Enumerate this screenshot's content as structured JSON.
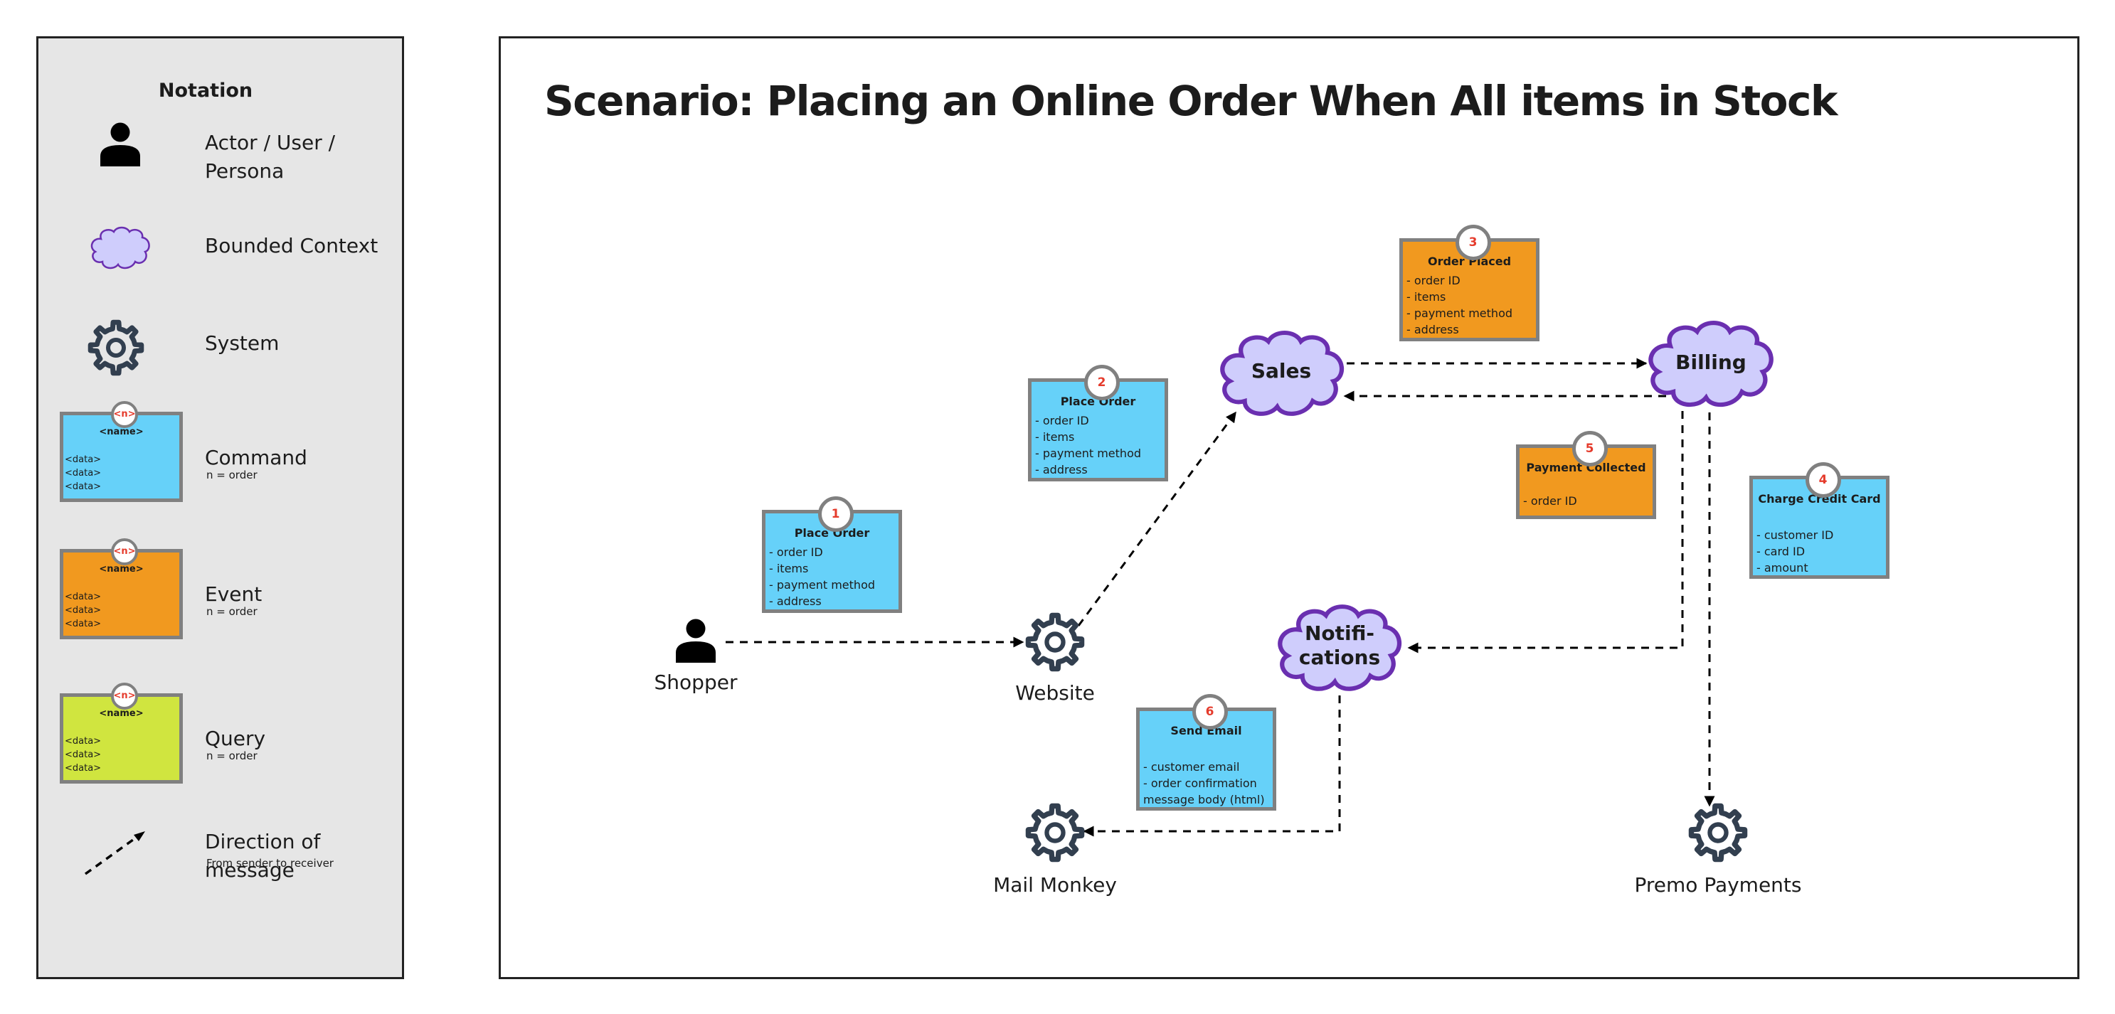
{
  "legend": {
    "title": "Notation",
    "items": [
      {
        "icon": "actor-icon",
        "label_line1": "Actor / User /",
        "label_line2": "Persona"
      },
      {
        "icon": "bounded-context-cloud-icon",
        "label": "Bounded Context"
      },
      {
        "icon": "system-gear-icon",
        "label": "System"
      },
      {
        "icon": "command-card",
        "label": "Command",
        "sub": "n = order",
        "card": {
          "badge": "<n>",
          "name": "<name>",
          "lines": [
            "<data>",
            "<data>",
            "<data>"
          ]
        }
      },
      {
        "icon": "event-card",
        "label": "Event",
        "sub": "n = order",
        "card": {
          "badge": "<n>",
          "name": "<name>",
          "lines": [
            "<data>",
            "<data>",
            "<data>"
          ]
        }
      },
      {
        "icon": "query-card",
        "label": "Query",
        "sub": "n = order",
        "card": {
          "badge": "<n>",
          "name": "<name>",
          "lines": [
            "<data>",
            "<data>",
            "<data>"
          ]
        }
      },
      {
        "icon": "dashed-arrow-icon",
        "label": "Direction of message",
        "sub": "From sender to receiver"
      }
    ]
  },
  "scenario": {
    "title": "Scenario: Placing an Online Order When All items in Stock",
    "actors": [
      {
        "name": "Shopper"
      }
    ],
    "systems": [
      {
        "name": "Website"
      },
      {
        "name": "Mail Monkey"
      },
      {
        "name": "Premo Payments"
      }
    ],
    "bounded_contexts": [
      {
        "name": "Sales"
      },
      {
        "name": "Billing"
      },
      {
        "name_line1": "Notifi-",
        "name_line2": "cations"
      }
    ],
    "messages": [
      {
        "order": "1",
        "type": "command",
        "name": "Place Order",
        "fields": [
          "- order ID",
          "- items",
          "- payment method",
          "- address"
        ],
        "from": "Shopper",
        "to": "Website"
      },
      {
        "order": "2",
        "type": "command",
        "name": "Place Order",
        "fields": [
          "- order ID",
          "- items",
          "- payment method",
          "- address"
        ],
        "from": "Website",
        "to": "Sales"
      },
      {
        "order": "3",
        "type": "event",
        "name": "Order Placed",
        "fields": [
          "- order ID",
          "- items",
          "- payment method",
          "- address"
        ],
        "from": "Sales",
        "to": "Billing"
      },
      {
        "order": "4",
        "type": "command",
        "name": "Charge Credit Card",
        "fields": [
          "- customer ID",
          "- card ID",
          "- amount"
        ],
        "from": "Billing",
        "to": "Premo Payments"
      },
      {
        "order": "5",
        "type": "event",
        "name": "Payment Collected",
        "fields": [
          "- order ID"
        ],
        "from": "Billing",
        "to": "Sales, Notifications"
      },
      {
        "order": "6",
        "type": "command",
        "name": "Send Email",
        "fields": [
          "- customer email",
          "- order confirmation",
          "message body (html)"
        ],
        "from": "Notifications",
        "to": "Mail Monkey"
      }
    ]
  },
  "colors": {
    "command": "#66d1f9",
    "event": "#f1991f",
    "query": "#d0e53f",
    "bounded_context_fill": "#cfcdfc",
    "bounded_context_stroke": "#6a2fb0",
    "system_gear": "#323f4f",
    "badge_number": "#e53b2c",
    "legend_bg": "#e6e6e6"
  }
}
